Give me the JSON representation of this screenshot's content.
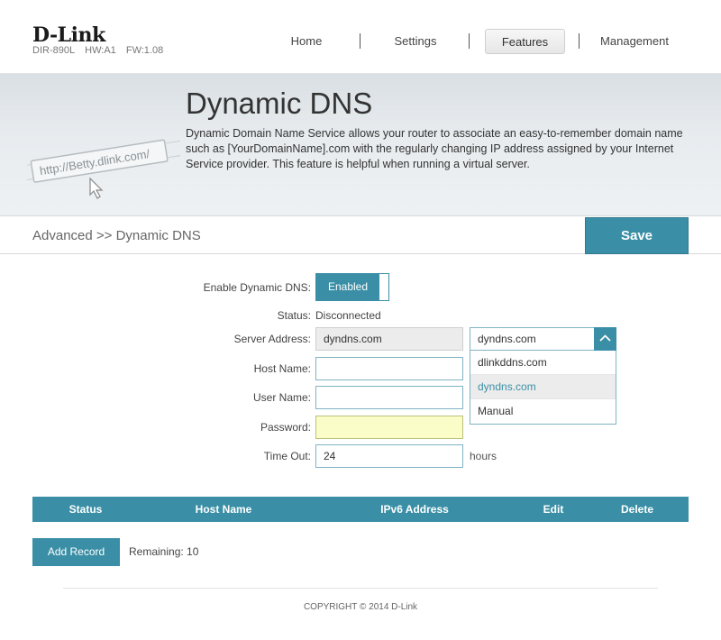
{
  "header": {
    "logo": "D-Link",
    "model": "DIR-890L",
    "hw": "HW:A1",
    "fw": "FW:1.08"
  },
  "nav": {
    "items": [
      {
        "label": "Home",
        "active": false
      },
      {
        "label": "Settings",
        "active": false
      },
      {
        "label": "Features",
        "active": true
      },
      {
        "label": "Management",
        "active": false
      }
    ]
  },
  "banner": {
    "title": "Dynamic DNS",
    "description": "Dynamic Domain Name Service allows your router to associate an easy-to-remember domain name such as [YourDomainName].com with the regularly changing IP address assigned by your Internet Service provider. This feature is helpful when running a virtual server.",
    "art_text": "http://Betty.dlink.com/"
  },
  "breadcrumb": "Advanced >> Dynamic DNS",
  "save_label": "Save",
  "form": {
    "enable_label": "Enable Dynamic DNS:",
    "enable_value": "Enabled",
    "status_label": "Status:",
    "status_value": "Disconnected",
    "server_label": "Server Address:",
    "server_value": "dyndns.com",
    "host_label": "Host Name:",
    "host_value": "",
    "user_label": "User Name:",
    "user_value": "",
    "password_label": "Password:",
    "password_value": "",
    "timeout_label": "Time Out:",
    "timeout_value": "24",
    "timeout_unit": "hours"
  },
  "server_dropdown": {
    "selected": "dyndns.com",
    "options": [
      "dlinkddns.com",
      "dyndns.com",
      "Manual"
    ],
    "highlighted_index": 1
  },
  "table": {
    "columns": [
      "Status",
      "Host Name",
      "IPv6 Address",
      "Edit",
      "Delete"
    ]
  },
  "add_record_label": "Add Record",
  "remaining": "Remaining: 10",
  "copyright": "COPYRIGHT © 2014 D-Link",
  "colors": {
    "accent": "#3a8fa6",
    "password_bg": "#fbfdc9"
  }
}
